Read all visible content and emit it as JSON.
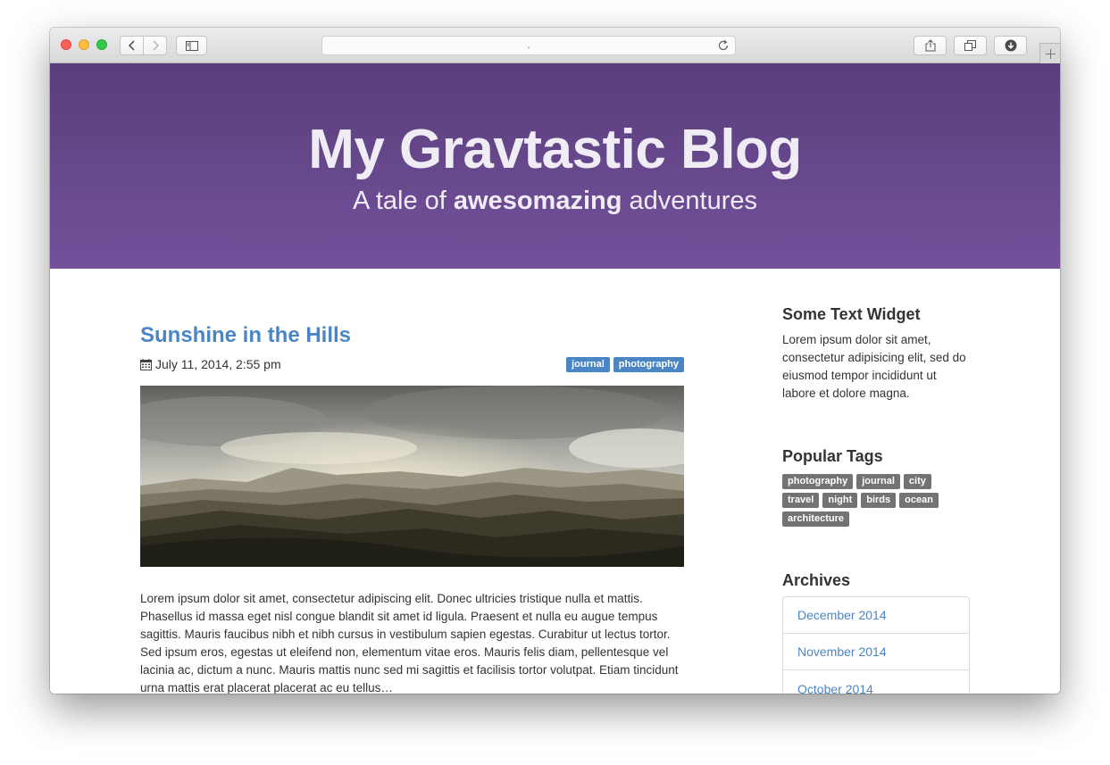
{
  "browser": {
    "url": ".",
    "icons": [
      "back-icon",
      "forward-icon",
      "sidebar-icon",
      "reload-icon",
      "share-icon",
      "tabs-icon",
      "download-icon",
      "new-tab-icon"
    ]
  },
  "header": {
    "title": "My Gravtastic Blog",
    "subtitle_pre": "A tale of ",
    "subtitle_bold": "awesomazing",
    "subtitle_post": " adventures",
    "gradient_top": "#593e7c",
    "gradient_bottom": "#74519b"
  },
  "post": {
    "title": "Sunshine in the Hills",
    "date": "July 11, 2014, 2:55 pm",
    "tags": [
      "journal",
      "photography"
    ],
    "excerpt": "Lorem ipsum dolor sit amet, consectetur adipiscing elit. Donec ultricies tristique nulla et mattis. Phasellus id massa eget nisl congue blandit sit amet id ligula. Praesent et nulla eu augue tempus sagittis. Mauris faucibus nibh et nibh cursus in vestibulum sapien egestas. Curabitur ut lectus tortor. Sed ipsum eros, egestas ut eleifend non, elementum vitae eros. Mauris felis diam, pellentesque vel lacinia ac, dictum a nunc. Mauris mattis nunc sed mi sagittis et facilisis tortor volutpat. Etiam tincidunt urna mattis erat placerat placerat ac eu tellus…"
  },
  "sidebar": {
    "text_widget": {
      "title": "Some Text Widget",
      "text": "Lorem ipsum dolor sit amet, consectetur adipisicing elit, sed do eiusmod tempor incididunt ut labore et dolore magna."
    },
    "popular_tags": {
      "title": "Popular Tags",
      "tags": [
        "photography",
        "journal",
        "city",
        "travel",
        "night",
        "birds",
        "ocean",
        "architecture"
      ]
    },
    "archives": {
      "title": "Archives",
      "items": [
        "December 2014",
        "November 2014",
        "October 2014"
      ]
    }
  },
  "colors": {
    "link": "#4a86c5",
    "tag_gray": "#737373"
  }
}
